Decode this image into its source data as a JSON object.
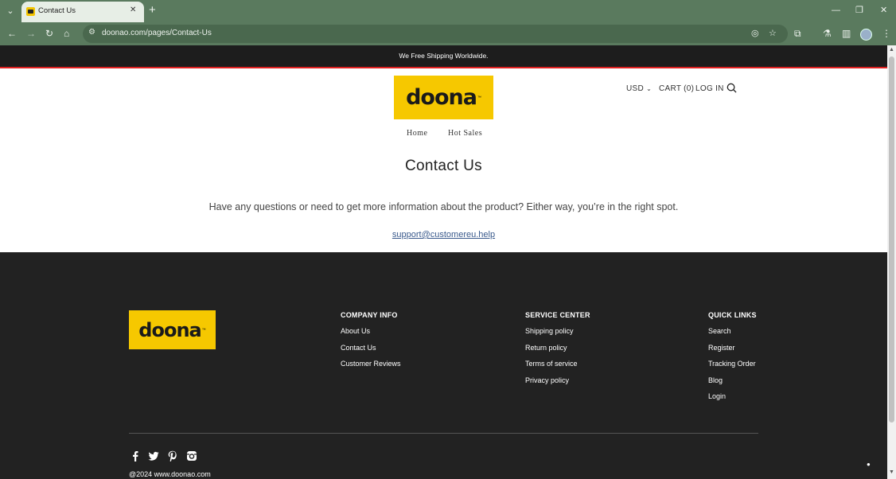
{
  "browser": {
    "tab_title": "Contact Us",
    "url": "doonao.com/pages/Contact-Us"
  },
  "announcement": "We Free Shipping Worldwide.",
  "brand": {
    "logo_text": "doona",
    "logo_tm": "™",
    "logo_color": "#f6c800"
  },
  "header": {
    "currency": "USD",
    "cart": "CART (0)",
    "login": "LOG IN"
  },
  "nav": [
    "Home",
    "Hot Sales"
  ],
  "page": {
    "title": "Contact Us",
    "intro": "Have any questions or need to get more information about the product? Either way, you’re in the right spot.",
    "email": "support@customereu.help"
  },
  "footer": {
    "company": {
      "heading": "COMPANY INFO",
      "links": [
        "About Us",
        "Contact Us",
        "Customer Reviews"
      ]
    },
    "service": {
      "heading": "SERVICE CENTER",
      "links": [
        "Shipping policy",
        "Return policy",
        "Terms of service",
        "Privacy policy"
      ]
    },
    "quick": {
      "heading": "QUICK LINKS",
      "links": [
        "Search",
        "Register",
        "Tracking Order",
        "Blog",
        "Login"
      ]
    },
    "social": [
      "facebook-icon",
      "twitter-icon",
      "pinterest-icon",
      "instagram-icon"
    ],
    "copyright": "@2024 www.doonao.com"
  }
}
